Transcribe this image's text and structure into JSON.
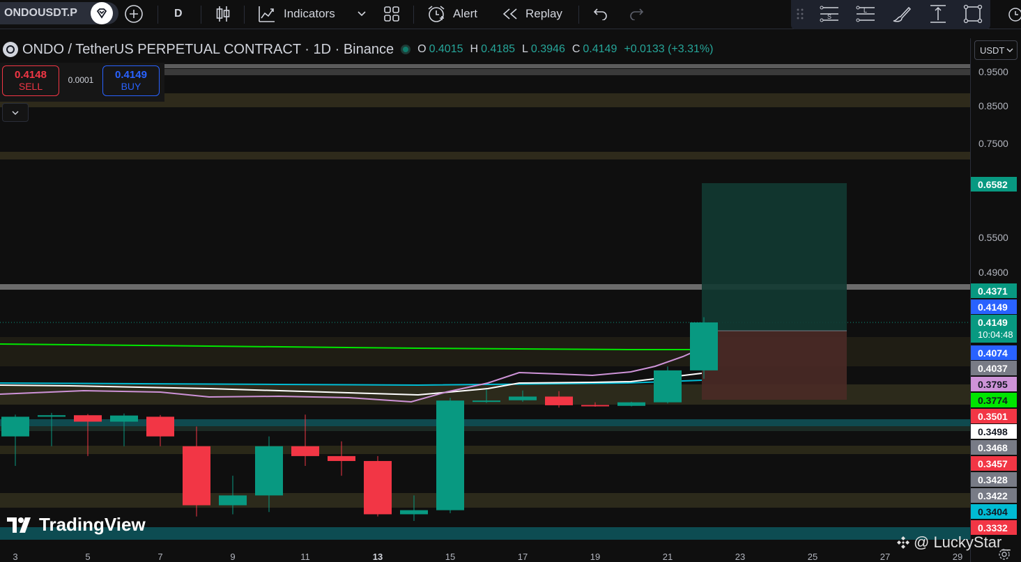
{
  "toolbar": {
    "symbol": "ONDOUSDT.P",
    "interval": "D",
    "indicators_label": "Indicators",
    "alert_label": "Alert",
    "replay_label": "Replay"
  },
  "header": {
    "title": "ONDO / TetherUS PERPETUAL CONTRACT · 1D · Binance",
    "o_key": "O",
    "o": "0.4015",
    "h_key": "H",
    "h": "0.4185",
    "l_key": "L",
    "l": "0.3946",
    "c_key": "C",
    "c": "0.4149",
    "change": "+0.0133 (+3.31%)"
  },
  "trade": {
    "sell_price": "0.4148",
    "sell_label": "SELL",
    "spread": "0.0001",
    "buy_price": "0.4149",
    "buy_label": "BUY"
  },
  "price_scale": {
    "currency": "USDT",
    "ticks": [
      "0.9500",
      "0.8500",
      "0.7500",
      "0.5500",
      "0.4900"
    ],
    "labels": [
      {
        "text": "0.6582",
        "color": "#089981",
        "fg": "#ffffff"
      },
      {
        "text": "0.4371",
        "color": "#089981",
        "fg": "#ffffff"
      },
      {
        "text": "0.4149",
        "color": "#2962ff",
        "fg": "#ffffff"
      },
      {
        "text": "0.4149",
        "color": "#089981",
        "fg": "#ffffff"
      },
      {
        "text": "10:04:48",
        "color": "#089981",
        "fg": "#ffffff"
      },
      {
        "text": "0.4074",
        "color": "#2962ff",
        "fg": "#ffffff"
      },
      {
        "text": "0.4037",
        "color": "#787b86",
        "fg": "#ffffff"
      },
      {
        "text": "0.3795",
        "color": "#ce93d8",
        "fg": "#131722"
      },
      {
        "text": "0.3774",
        "color": "#00e600",
        "fg": "#131722"
      },
      {
        "text": "0.3501",
        "color": "#f23645",
        "fg": "#ffffff"
      },
      {
        "text": "0.3498",
        "color": "#ffffff",
        "fg": "#131722"
      },
      {
        "text": "0.3468",
        "color": "#787b86",
        "fg": "#ffffff"
      },
      {
        "text": "0.3457",
        "color": "#f23645",
        "fg": "#ffffff"
      },
      {
        "text": "0.3428",
        "color": "#787b86",
        "fg": "#ffffff"
      },
      {
        "text": "0.3422",
        "color": "#787b86",
        "fg": "#ffffff"
      },
      {
        "text": "0.3404",
        "color": "#00bcd4",
        "fg": "#131722"
      },
      {
        "text": "0.3332",
        "color": "#f23645",
        "fg": "#ffffff"
      }
    ]
  },
  "time_axis": {
    "ticks": [
      "3",
      "5",
      "7",
      "9",
      "11",
      "13",
      "15",
      "17",
      "19",
      "21",
      "23",
      "25",
      "27",
      "29"
    ],
    "bold_tick": "13"
  },
  "branding": {
    "logo_text": "TradingView",
    "watermark": "@ LuckyStar_"
  },
  "colors": {
    "up": "#089981",
    "down": "#f23645",
    "ma_green": "#00e600",
    "ma_purple": "#ce93d8",
    "ma_white": "#ffffff",
    "ma_cyan": "#00bcd4"
  },
  "chart_data": {
    "type": "candlestick",
    "x": [
      "2",
      "3",
      "4",
      "5",
      "6",
      "7",
      "8",
      "9",
      "10",
      "11",
      "12",
      "13",
      "14",
      "15",
      "16",
      "17",
      "18",
      "19",
      "20",
      "21",
      "22"
    ],
    "candles": [
      {
        "x": "2",
        "o": 0.348,
        "h": 0.352,
        "l": 0.345,
        "c": 0.35
      },
      {
        "x": "3",
        "o": 0.35,
        "h": 0.355,
        "l": 0.347,
        "c": 0.351
      },
      {
        "x": "4",
        "o": 0.351,
        "h": 0.353,
        "l": 0.346,
        "c": 0.3495
      },
      {
        "x": "5",
        "o": 0.3495,
        "h": 0.354,
        "l": 0.347,
        "c": 0.3505
      },
      {
        "x": "6",
        "o": 0.35,
        "h": 0.3515,
        "l": 0.347,
        "c": 0.348
      },
      {
        "x": "7",
        "o": 0.347,
        "h": 0.349,
        "l": 0.338,
        "c": 0.341
      },
      {
        "x": "8",
        "o": 0.341,
        "h": 0.344,
        "l": 0.339,
        "c": 0.342
      },
      {
        "x": "9",
        "o": 0.342,
        "h": 0.348,
        "l": 0.34,
        "c": 0.347
      },
      {
        "x": "10",
        "o": 0.347,
        "h": 0.352,
        "l": 0.345,
        "c": 0.346
      },
      {
        "x": "11",
        "o": 0.346,
        "h": 0.3475,
        "l": 0.344,
        "c": 0.3455
      },
      {
        "x": "12",
        "o": 0.3455,
        "h": 0.346,
        "l": 0.338,
        "c": 0.339
      },
      {
        "x": "13",
        "o": 0.339,
        "h": 0.342,
        "l": 0.336,
        "c": 0.3405
      },
      {
        "x": "14",
        "o": 0.3405,
        "h": 0.379,
        "l": 0.3395,
        "c": 0.376
      },
      {
        "x": "15",
        "o": 0.3755,
        "h": 0.386,
        "l": 0.372,
        "c": 0.376
      },
      {
        "x": "16",
        "o": 0.3765,
        "h": 0.385,
        "l": 0.374,
        "c": 0.38
      },
      {
        "x": "17",
        "o": 0.38,
        "h": 0.3845,
        "l": 0.364,
        "c": 0.368
      },
      {
        "x": "18",
        "o": 0.3685,
        "h": 0.373,
        "l": 0.3655,
        "c": 0.367
      },
      {
        "x": "19",
        "o": 0.367,
        "h": 0.374,
        "l": 0.366,
        "c": 0.373
      },
      {
        "x": "20",
        "o": 0.373,
        "h": 0.404,
        "l": 0.371,
        "c": 0.4015
      },
      {
        "x": "21",
        "o": 0.4015,
        "h": 0.4185,
        "l": 0.3946,
        "c": 0.4149
      }
    ],
    "price_range": [
      0.33,
      0.98
    ],
    "position": {
      "entry": 0.4149,
      "target": 0.6582,
      "stop": 0.3774
    }
  }
}
